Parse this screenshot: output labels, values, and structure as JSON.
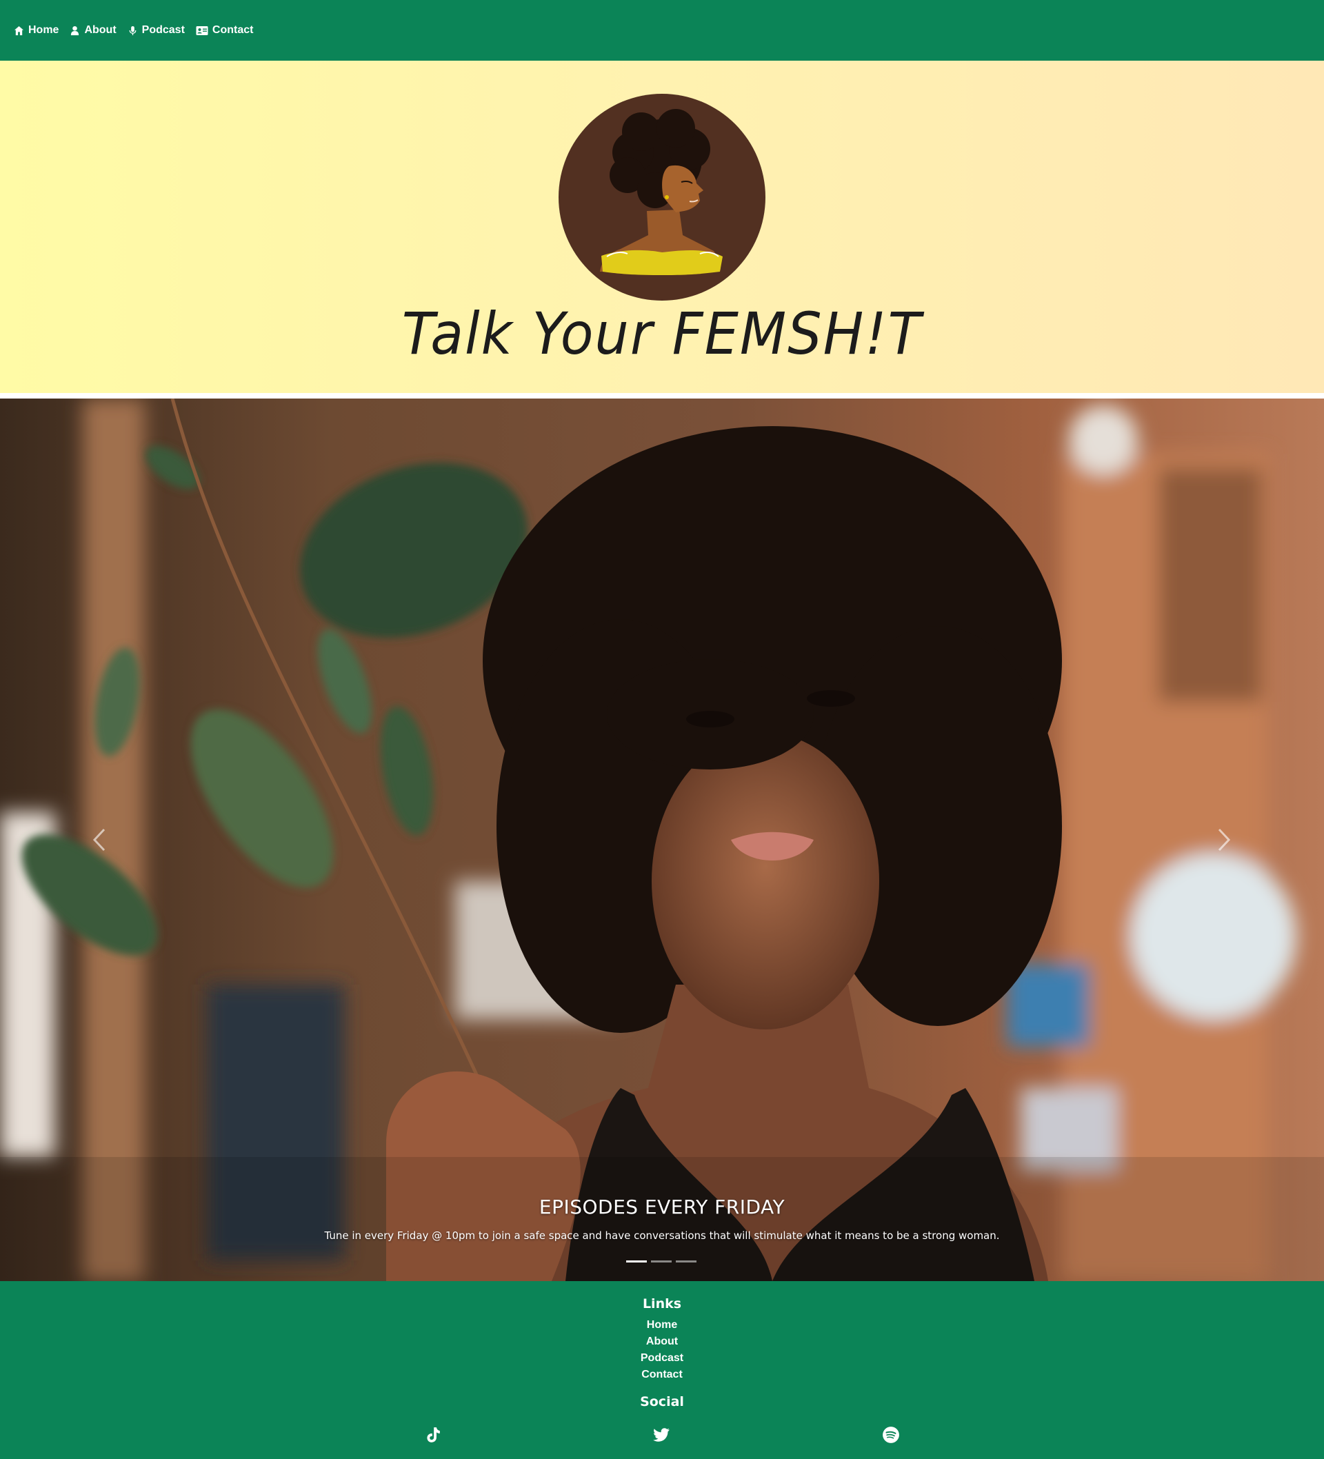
{
  "nav": {
    "items": [
      {
        "label": "Home",
        "icon": "home-icon"
      },
      {
        "label": "About",
        "icon": "user-icon"
      },
      {
        "label": "Podcast",
        "icon": "microphone-icon"
      },
      {
        "label": "Contact",
        "icon": "id-card-icon"
      }
    ]
  },
  "header": {
    "title": "Talk Your FEMSH!T",
    "logo": "woman-silhouette-logo"
  },
  "carousel": {
    "slide_title": "EPISODES EVERY FRIDAY",
    "slide_text": "Tune in every Friday @ 10pm to join a safe space and have conversations that will stimulate what it means to be a strong woman.",
    "slide_count": 3,
    "active_index": 0
  },
  "footer": {
    "links_heading": "Links",
    "links": [
      "Home",
      "About",
      "Podcast",
      "Contact"
    ],
    "social_heading": "Social",
    "social": [
      "tiktok-icon",
      "twitter-icon",
      "spotify-icon"
    ]
  },
  "colors": {
    "primary_green": "#0b8457",
    "header_yellow": "#fff6ab",
    "text_dark": "#1c1c1c"
  }
}
